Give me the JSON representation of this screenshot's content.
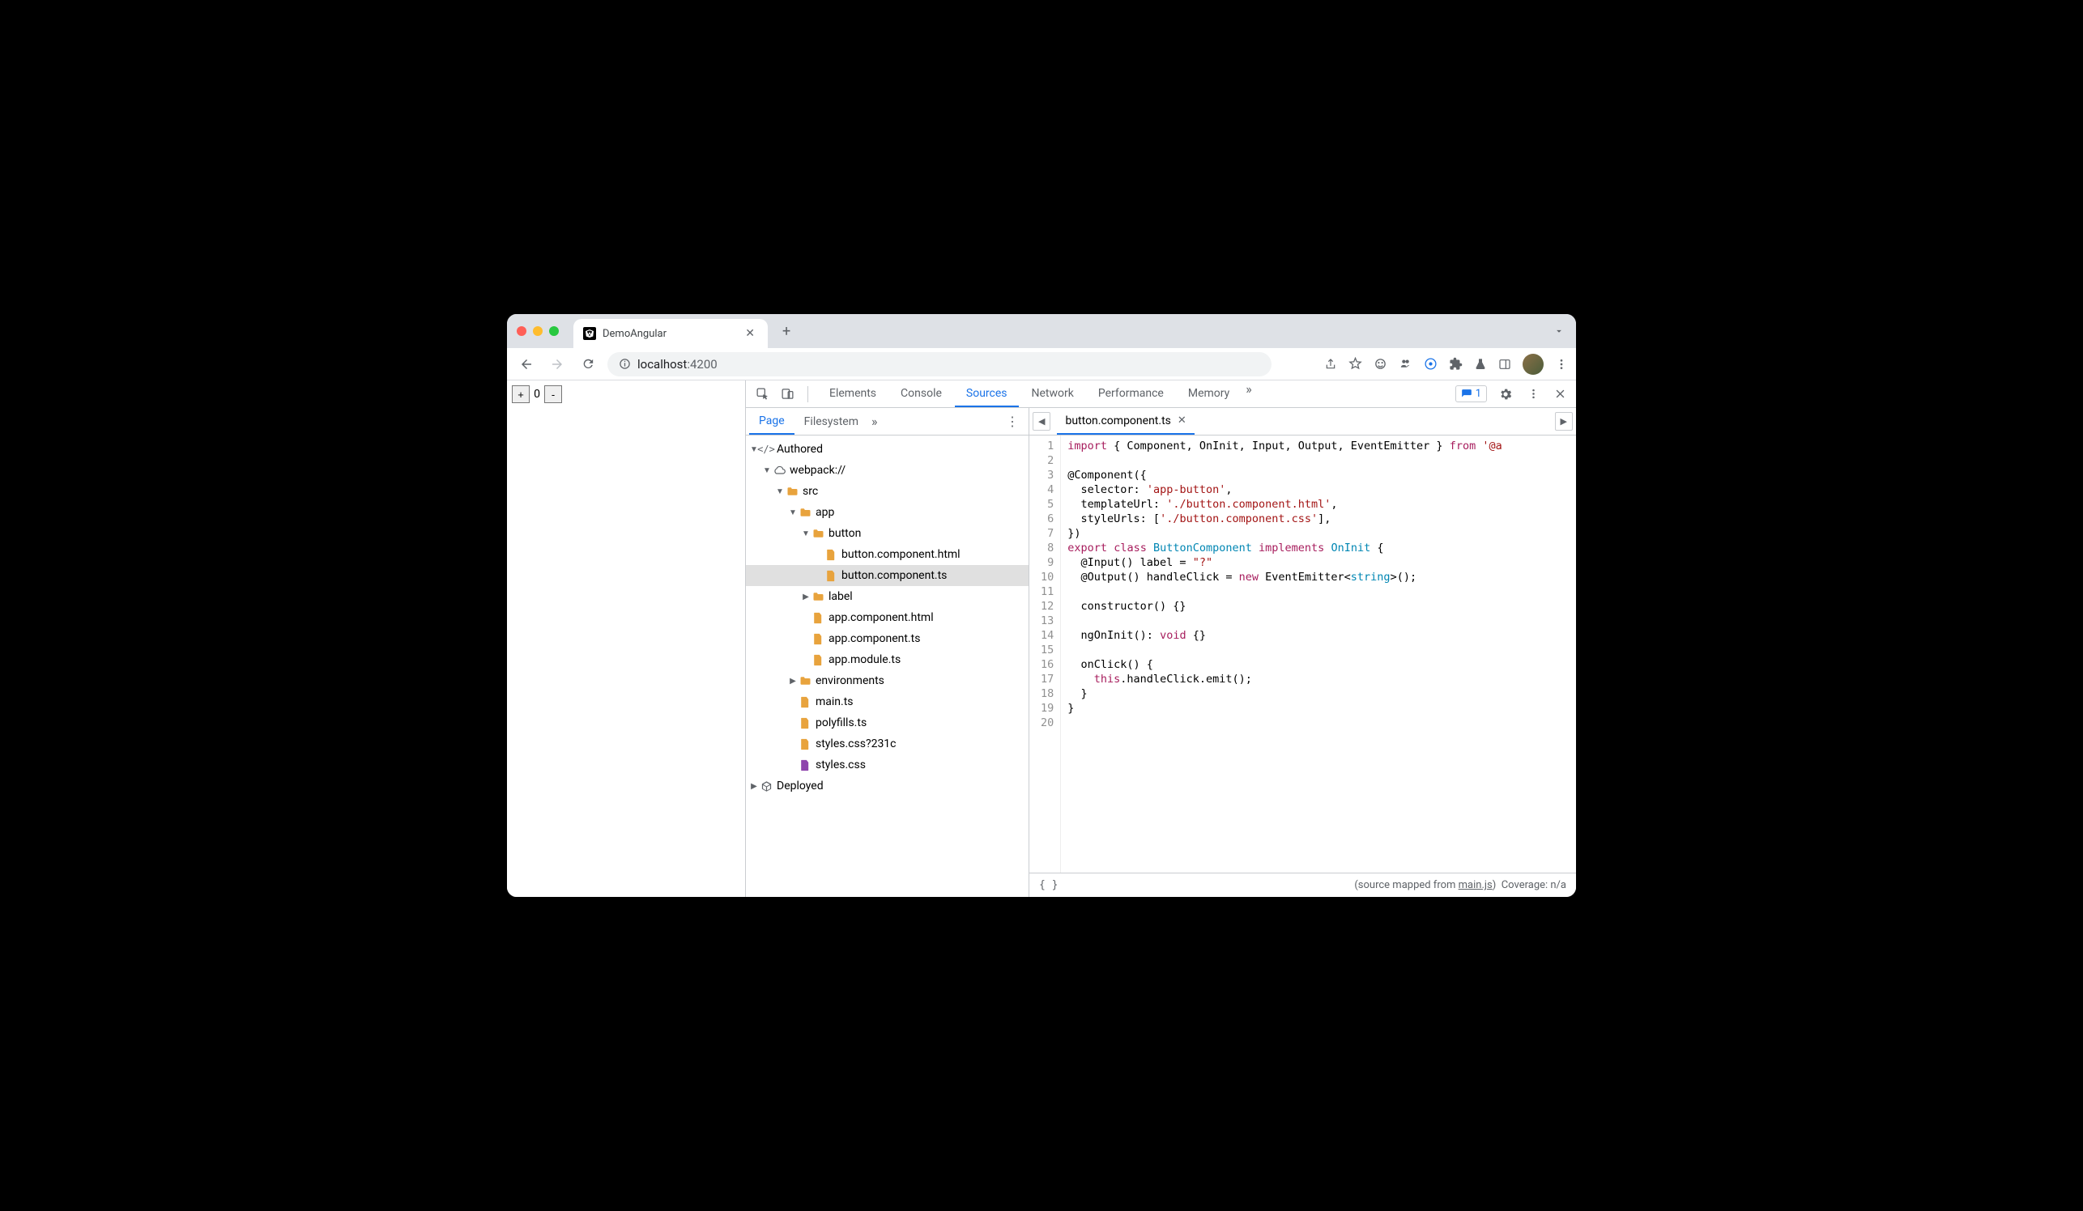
{
  "browser": {
    "tab_title": "DemoAngular",
    "url_host": "localhost",
    "url_port": ":4200"
  },
  "page": {
    "counter": "0"
  },
  "devtools": {
    "panels": [
      "Elements",
      "Console",
      "Sources",
      "Network",
      "Performance",
      "Memory"
    ],
    "active_panel": "Sources",
    "issues_count": "1",
    "sources": {
      "nav_tabs": [
        "Page",
        "Filesystem"
      ],
      "active_nav": "Page",
      "tree": {
        "authored": "Authored",
        "webpack": "webpack://",
        "src": "src",
        "app": "app",
        "button": "button",
        "button_html": "button.component.html",
        "button_ts": "button.component.ts",
        "label": "label",
        "app_html": "app.component.html",
        "app_ts": "app.component.ts",
        "app_module": "app.module.ts",
        "environments": "environments",
        "main_ts": "main.ts",
        "polyfills": "polyfills.ts",
        "styles_q": "styles.css?231c",
        "styles": "styles.css",
        "deployed": "Deployed"
      },
      "open_file": "button.component.ts",
      "status": {
        "mapped_prefix": "(source mapped from ",
        "mapped_link": "main.js",
        "mapped_suffix": ")",
        "coverage": "Coverage: n/a"
      }
    }
  },
  "code": {
    "lines": [
      {
        "n": "1",
        "tokens": [
          [
            "kw",
            "import"
          ],
          [
            "",
            " { Component, OnInit, Input, Output, EventEmitter } "
          ],
          [
            "kw",
            "from"
          ],
          [
            "",
            " "
          ],
          [
            "str",
            "'@a"
          ]
        ]
      },
      {
        "n": "2",
        "tokens": [
          [
            "",
            ""
          ]
        ]
      },
      {
        "n": "3",
        "tokens": [
          [
            "",
            "@Component({"
          ]
        ]
      },
      {
        "n": "4",
        "tokens": [
          [
            "",
            "  selector: "
          ],
          [
            "str",
            "'app-button'"
          ],
          [
            "",
            ","
          ]
        ]
      },
      {
        "n": "5",
        "tokens": [
          [
            "",
            "  templateUrl: "
          ],
          [
            "str",
            "'./button.component.html'"
          ],
          [
            "",
            ","
          ]
        ]
      },
      {
        "n": "6",
        "tokens": [
          [
            "",
            "  styleUrls: ["
          ],
          [
            "str",
            "'./button.component.css'"
          ],
          [
            "",
            "],"
          ]
        ]
      },
      {
        "n": "7",
        "tokens": [
          [
            "",
            "})"
          ]
        ]
      },
      {
        "n": "8",
        "tokens": [
          [
            "kw",
            "export"
          ],
          [
            "",
            " "
          ],
          [
            "kw",
            "class"
          ],
          [
            "",
            " "
          ],
          [
            "cls",
            "ButtonComponent"
          ],
          [
            "",
            " "
          ],
          [
            "kw",
            "implements"
          ],
          [
            "",
            " "
          ],
          [
            "cls",
            "OnInit"
          ],
          [
            "",
            " {"
          ]
        ]
      },
      {
        "n": "9",
        "tokens": [
          [
            "",
            "  @Input() label = "
          ],
          [
            "str",
            "\"?\""
          ]
        ]
      },
      {
        "n": "10",
        "tokens": [
          [
            "",
            "  @Output() handleClick = "
          ],
          [
            "kw",
            "new"
          ],
          [
            "",
            " EventEmitter<"
          ],
          [
            "cls",
            "string"
          ],
          [
            "",
            ">();"
          ]
        ]
      },
      {
        "n": "11",
        "tokens": [
          [
            "",
            ""
          ]
        ]
      },
      {
        "n": "12",
        "tokens": [
          [
            "",
            "  constructor() {}"
          ]
        ]
      },
      {
        "n": "13",
        "tokens": [
          [
            "",
            ""
          ]
        ]
      },
      {
        "n": "14",
        "tokens": [
          [
            "",
            "  ngOnInit(): "
          ],
          [
            "kw",
            "void"
          ],
          [
            "",
            " {}"
          ]
        ]
      },
      {
        "n": "15",
        "tokens": [
          [
            "",
            ""
          ]
        ]
      },
      {
        "n": "16",
        "tokens": [
          [
            "",
            "  onClick() {"
          ]
        ]
      },
      {
        "n": "17",
        "tokens": [
          [
            "",
            "    "
          ],
          [
            "kw",
            "this"
          ],
          [
            "",
            ".handleClick.emit();"
          ]
        ]
      },
      {
        "n": "18",
        "tokens": [
          [
            "",
            "  }"
          ]
        ]
      },
      {
        "n": "19",
        "tokens": [
          [
            "",
            "}"
          ]
        ]
      },
      {
        "n": "20",
        "tokens": [
          [
            "",
            ""
          ]
        ]
      }
    ]
  }
}
